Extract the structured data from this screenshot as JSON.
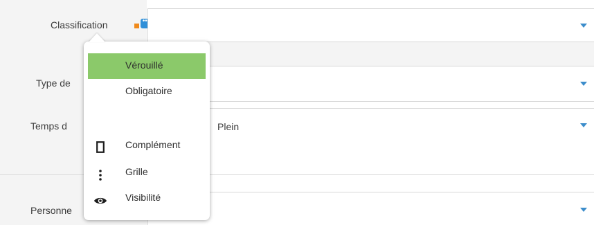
{
  "fields": [
    {
      "label": "Classification",
      "value": ""
    },
    {
      "label": "Type de",
      "value": ""
    },
    {
      "label": "Temps d",
      "value": "Plein"
    },
    {
      "label": "Personne",
      "value": ""
    }
  ],
  "badge": {
    "dots": "•••"
  },
  "popup_menu": {
    "items": [
      {
        "label": "Vérouillé",
        "icon": "",
        "active": true
      },
      {
        "label": "Obligatoire",
        "icon": "",
        "active": false
      },
      {
        "label": "Complément",
        "icon": "document-icon",
        "active": false
      },
      {
        "label": "Grille",
        "icon": "vertical-dots-icon",
        "active": false
      },
      {
        "label": "Visibilité",
        "icon": "eye-icon",
        "active": false
      }
    ]
  },
  "colors": {
    "accent_blue": "#3c8dcb",
    "active_item": "#8bc96a",
    "badge_orange": "#f08a1c",
    "badge_blue": "#2f8fd8"
  }
}
